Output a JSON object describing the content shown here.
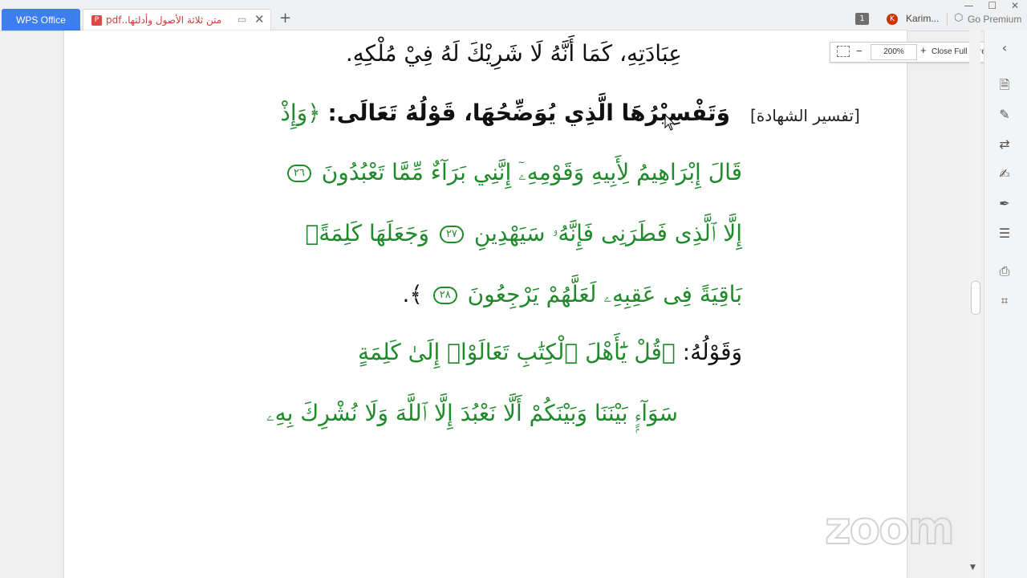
{
  "tabs": {
    "home_label": "WPS Office",
    "doc_label": "متن ثلاثة الأصول وأدلتها..pdf",
    "doc_icon": "pdf-icon",
    "add_tab": "+"
  },
  "header": {
    "count_badge": "1",
    "avatar_letter": "K",
    "username": "Karim...",
    "premium_label": "Go Premium",
    "win_min": "—",
    "win_max": "☐",
    "win_close": "✕"
  },
  "document": {
    "line1": "عِبَادَتِهِ، كَمَا أَنَّهُ لَا شَرِيْكَ لَهُ فِيْ مُلْكِهِ.",
    "line2_bold": "وَتَفْسِيْرُهَا الَّذِي يُوَضِّحُهَا، قَوْلُهُ تَعَالَى:",
    "line2_green": "﴿وَإِذْ",
    "sidenote": "[تفسير الشهادة]",
    "line3": "قَالَ إِبْرَاهِيمُ لِأَبِيهِ وَقَوْمِهِۦٓ إِنَّنِي بَرَآءٌ مِّمَّا تَعْبُدُونَ",
    "ayah26": "٢٦",
    "line4a": "إِلَّا ٱلَّذِى فَطَرَنِى فَإِنَّهُۥ سَيَهْدِينِ",
    "ayah27": "٢٧",
    "line4b": "وَجَعَلَهَا كَلِمَةًۢ",
    "line5": "بَاقِيَةً فِى عَقِبِهِۦ لَعَلَّهُمْ يَرْجِعُونَ",
    "ayah28": "٢٨",
    "line5_end": "﴾.",
    "line6_black": "وَقَوْلُهُ:",
    "line6_green": "﴿قُلْ يَٰٓأَهْلَ ٱلْكِتَٰبِ تَعَالَوْا۟ إِلَىٰ كَلِمَةٍ",
    "line7": "سَوَآءٍۭ بَيْنَنَا وَبَيْنَكُمْ أَلَّا نَعْبُدَ إِلَّا ٱللَّهَ وَلَا نُشْرِكَ بِهِۦ"
  },
  "zoombar": {
    "zoom_value": "200%",
    "minus": "−",
    "plus": "+",
    "close_label": "Close Full Screen"
  },
  "watermark": "zoom",
  "colors": {
    "accent": "#3d7ef0",
    "quran_green": "#1f8a2a"
  }
}
